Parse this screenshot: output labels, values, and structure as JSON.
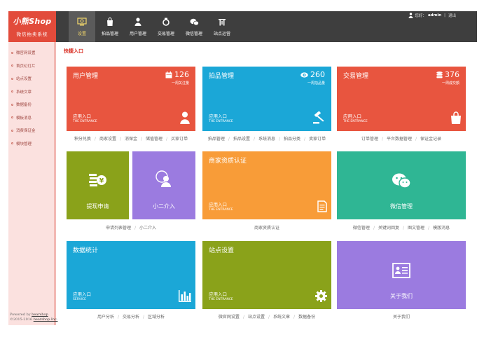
{
  "logo": {
    "brand": "小熊Shop",
    "subtitle": "微信拍卖系统"
  },
  "nav": [
    {
      "label": "设置",
      "icon": "settings-icon"
    },
    {
      "label": "拍品管理",
      "icon": "bag-icon"
    },
    {
      "label": "用户管理",
      "icon": "user-icon"
    },
    {
      "label": "交易管理",
      "icon": "trade-icon"
    },
    {
      "label": "微信管理",
      "icon": "wechat-icon"
    },
    {
      "label": "站点运营",
      "icon": "site-icon"
    }
  ],
  "user": {
    "greeting": "您好：",
    "name": "admin",
    "separator": "|",
    "logout": "退出"
  },
  "sidebar": [
    {
      "label": "微官网设置"
    },
    {
      "label": "首页幻灯片"
    },
    {
      "label": "站点设置"
    },
    {
      "label": "系统文章"
    },
    {
      "label": "数据备份"
    },
    {
      "label": "模板消息"
    },
    {
      "label": "消费保证金"
    },
    {
      "label": "模块管理"
    }
  ],
  "footer": {
    "powered": "Powered by",
    "powered_link": "bearshop",
    "copyright": "©2015-2016",
    "copyright_link": "bearshop.Inc."
  },
  "section_title": "快捷入口",
  "cards": {
    "users": {
      "title": "用户管理",
      "count": "126",
      "caption": "一周关注量",
      "entry": "应用入口",
      "entry_en": "THE ENTRANCE"
    },
    "items": {
      "title": "拍品管理",
      "count": "260",
      "caption": "一周拍品量",
      "entry": "应用入口",
      "entry_en": "THE ENTRANCE"
    },
    "trade": {
      "title": "交易管理",
      "count": "376",
      "caption": "一周成交额",
      "entry": "应用入口",
      "entry_en": "THE ENTRANCE"
    },
    "withdraw": {
      "label": "提现申请"
    },
    "assistant": {
      "label": "小二介入"
    },
    "merchant": {
      "title": "商家资质认证",
      "entry": "应用入口",
      "entry_en": "THE ENTRANCE"
    },
    "wechat": {
      "label": "微信管理"
    },
    "stats": {
      "title": "数据统计",
      "entry": "应用入口",
      "entry_en": "SERVICE"
    },
    "site": {
      "title": "站点设置",
      "entry": "应用入口",
      "entry_en": "THE ENTRANCE"
    },
    "about": {
      "label": "关于我们"
    }
  },
  "links": {
    "users": [
      "积分兑换",
      "商家设置",
      "消保金",
      "储值管理",
      "买家订单"
    ],
    "items": [
      "拍品管理",
      "拍品设置",
      "系统消息",
      "拍品分类",
      "卖家订单"
    ],
    "trade": [
      "订单管理",
      "平台数据管理",
      "保证金记录"
    ],
    "withdraw": [
      "申请列表管理",
      "小二介入"
    ],
    "merchant": [
      "商家资质认证"
    ],
    "wechat": [
      "微信管理",
      "关键词回复",
      "图文管理",
      "模版消息"
    ],
    "stats": [
      "用户分析",
      "交易分析",
      "区域分析"
    ],
    "site": [
      "微官网设置",
      "站点设置",
      "系统文章",
      "数据备份"
    ],
    "about": [
      "关于我们"
    ]
  },
  "colors": {
    "red": "#e8553f",
    "blue": "#1ba7d7",
    "olive": "#8aa21a",
    "purple": "#9b7be0",
    "orange": "#f89c38",
    "teal": "#2fb694",
    "topbar": "#3e3e3e",
    "accent": "#d8281c"
  }
}
